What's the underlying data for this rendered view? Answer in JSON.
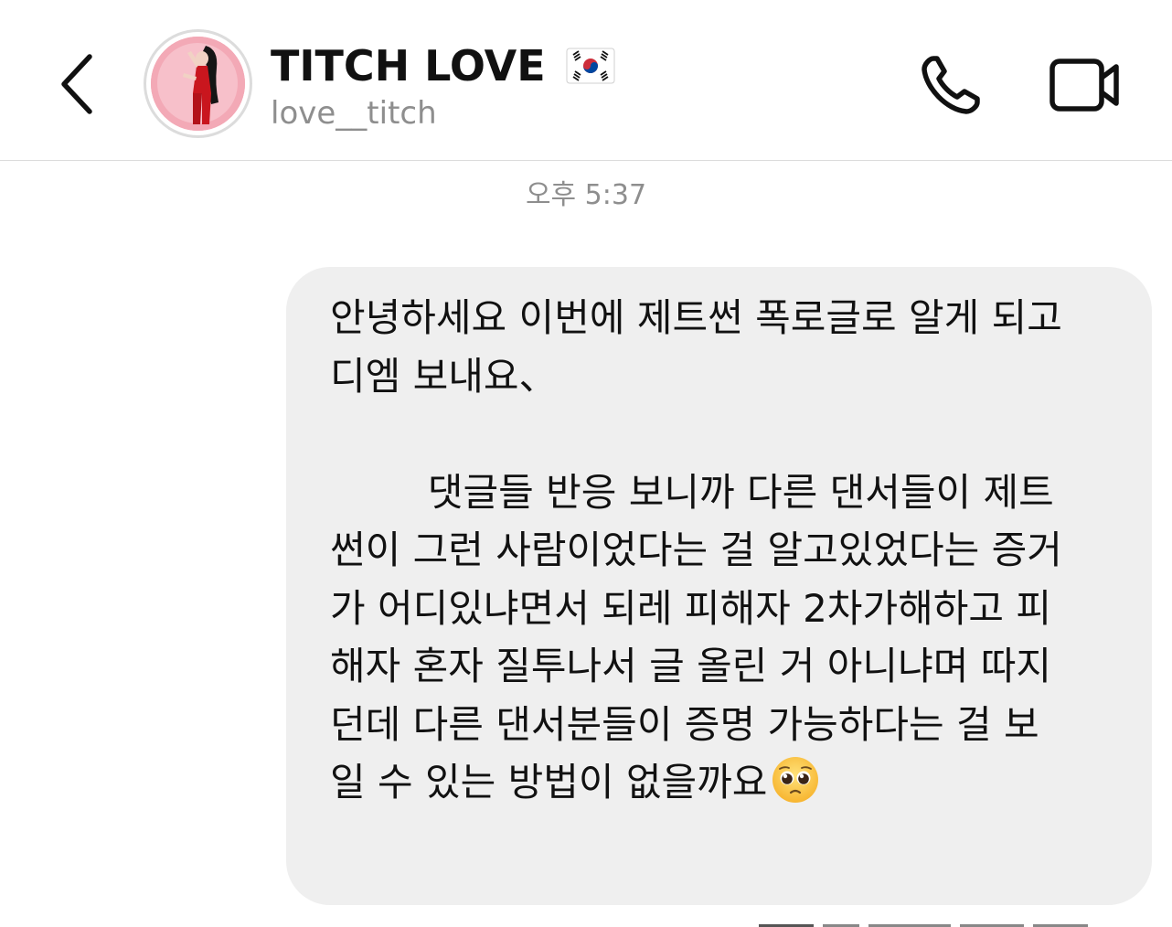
{
  "header": {
    "title": "TITCH LOVE",
    "username": "love__titch",
    "flag_icon": "korea-flag-icon",
    "back_icon": "chevron-left-icon",
    "call_icon": "phone-icon",
    "video_icon": "video-camera-icon"
  },
  "conversation": {
    "timestamp": "오후 5:37",
    "messages": [
      {
        "text": "안녕하세요 이번에 제트썬 폭로글로 알게 되고\n디엠 보내요、\n\n        댓글들 반응 보니까 다른 댄서들이 제트\n썬이 그런 사람이었다는 걸 알고있었다는 증거\n가 어디있냐면서 되레 피해자 2차가해하고 피\n해자 혼자 질투나서 글 올린 거 아니냐며 따지\n던데 다른 댄서분들이 증명 가능하다는 걸 보\n일 수 있는 방법이 없을까요",
        "emoji": "pleading-face-emoji"
      }
    ]
  },
  "colors": {
    "bubble_bg": "#efefef",
    "secondary_text": "#8e8e8e",
    "divider": "#dcdcdc"
  }
}
